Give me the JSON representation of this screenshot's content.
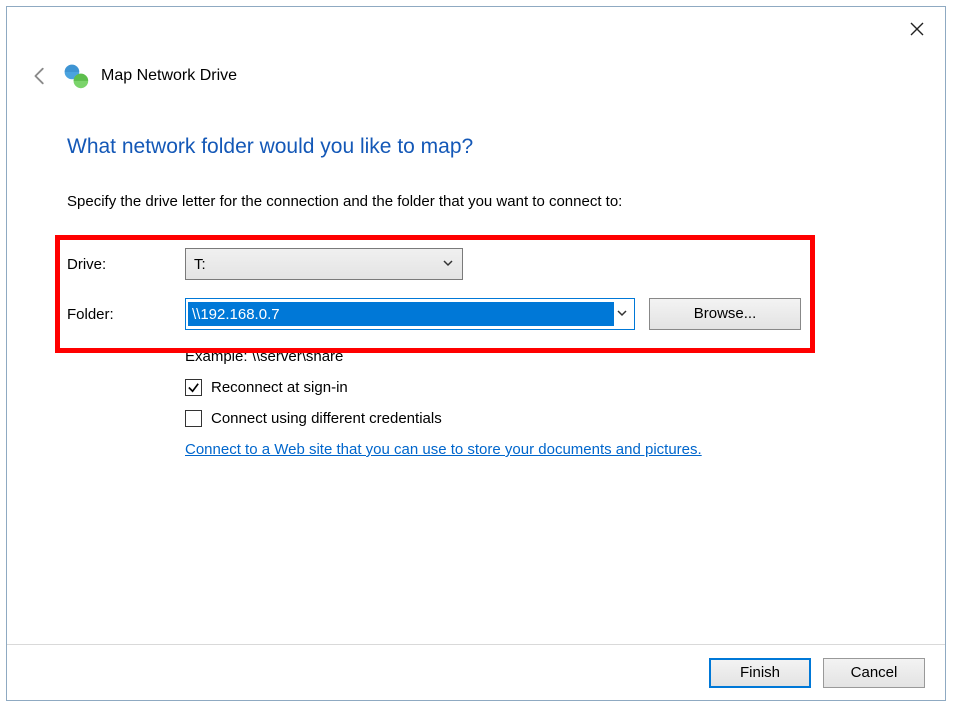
{
  "window": {
    "title": "Map Network Drive"
  },
  "heading": "What network folder would you like to map?",
  "instructions": "Specify the drive letter for the connection and the folder that you want to connect to:",
  "form": {
    "drive_label": "Drive:",
    "drive_value": "T:",
    "folder_label": "Folder:",
    "folder_value": "\\\\192.168.0.7",
    "browse_label": "Browse...",
    "example": "Example: \\\\server\\share",
    "reconnect_label": "Reconnect at sign-in",
    "reconnect_checked": true,
    "credentials_label": "Connect using different credentials",
    "credentials_checked": false,
    "link_text": "Connect to a Web site that you can use to store your documents and pictures"
  },
  "footer": {
    "finish": "Finish",
    "cancel": "Cancel"
  }
}
